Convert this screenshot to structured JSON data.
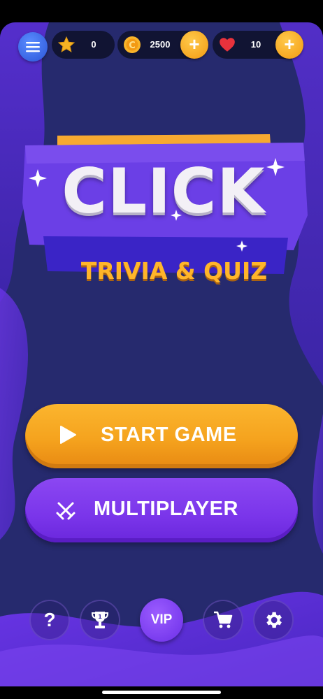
{
  "stats": {
    "stars": "0",
    "coins": "2500",
    "lives": "10"
  },
  "logo": {
    "title": "CLICK",
    "subtitle": "TRIVIA & QUIZ"
  },
  "buttons": {
    "start_game": "START GAME",
    "multiplayer": "MULTIPLAYER",
    "vip": "VIP"
  },
  "icons": {
    "menu": "hamburger-icon",
    "star": "star-icon",
    "coin": "coin-icon",
    "heart": "heart-icon",
    "plus": "plus-icon",
    "play": "play-icon",
    "swords": "crossed-swords-icon",
    "help": "question-icon",
    "leaderboard": "trophy-icon",
    "shop": "cart-icon",
    "settings": "gear-icon"
  },
  "colors": {
    "background": "#262a6e",
    "accent_orange": "#f5a31e",
    "accent_purple": "#7a35ea",
    "logo_yellow": "#ffb52a"
  }
}
